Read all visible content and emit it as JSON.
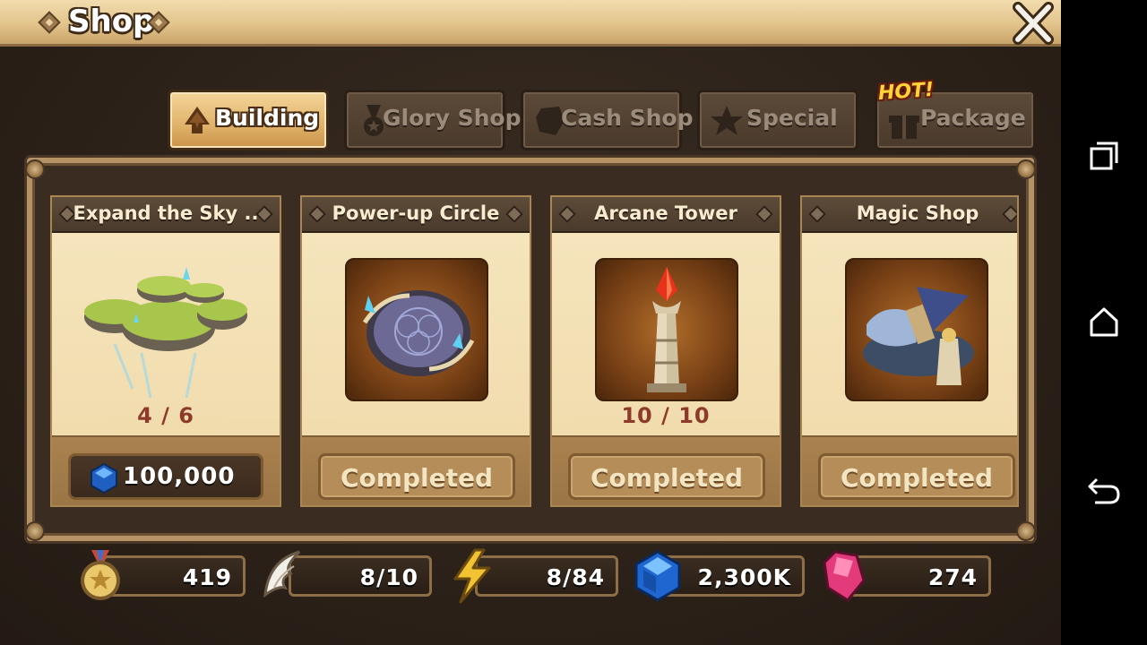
{
  "title": "Shop",
  "tabs": [
    {
      "label": "Building",
      "active": true,
      "icon": "building-icon"
    },
    {
      "label": "Glory Shop",
      "active": false,
      "icon": "medal-icon"
    },
    {
      "label": "Cash Shop",
      "active": false,
      "icon": "crystal-icon"
    },
    {
      "label": "Special",
      "active": false,
      "icon": "star-icon"
    },
    {
      "label": "Package",
      "active": false,
      "icon": "gift-icon"
    }
  ],
  "hot_badge": "HOT!",
  "cards": [
    {
      "title": "Expand the Sky ..",
      "count": "4 / 6",
      "action": "100,000",
      "action_type": "price",
      "image": "floating-islands-image"
    },
    {
      "title": "Power-up Circle",
      "count": "",
      "action": "Completed",
      "action_type": "completed",
      "image": "power-up-circle-image"
    },
    {
      "title": "Arcane Tower",
      "count": "10 / 10",
      "action": "Completed",
      "action_type": "completed",
      "image": "arcane-tower-image"
    },
    {
      "title": "Magic Shop",
      "count": "",
      "action": "Completed",
      "action_type": "completed",
      "image": "magic-shop-image"
    }
  ],
  "resources": [
    {
      "name": "glory-points",
      "value": "419",
      "icon": "medal-icon"
    },
    {
      "name": "arena-wings",
      "value": "8/10",
      "icon": "wing-icon"
    },
    {
      "name": "energy",
      "value": "8/84",
      "icon": "lightning-icon"
    },
    {
      "name": "mana-crystals",
      "value": "2,300K",
      "icon": "crystal-icon"
    },
    {
      "name": "gems",
      "value": "274",
      "icon": "gem-icon"
    }
  ],
  "colors": {
    "accent": "#e0b26a",
    "panel": "#3a2c20",
    "card": "#f6e6bf",
    "count_text": "#8e3a2a"
  }
}
